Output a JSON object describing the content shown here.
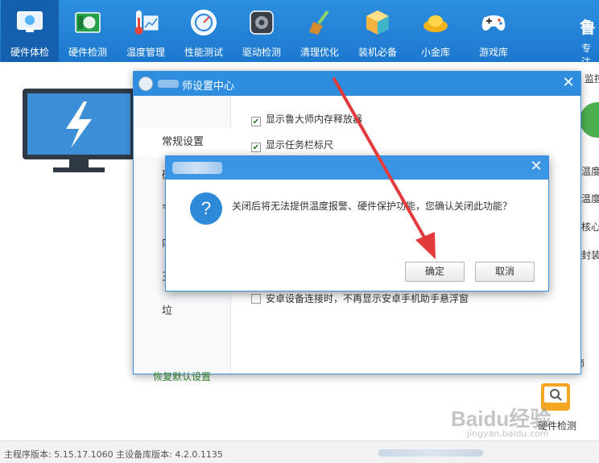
{
  "toolbar": {
    "items": [
      {
        "label": "硬件体检",
        "icon": "monitor-check-icon"
      },
      {
        "label": "硬件检测",
        "icon": "chip-board-icon"
      },
      {
        "label": "温度管理",
        "icon": "thermometer-icon"
      },
      {
        "label": "性能测试",
        "icon": "speedometer-icon"
      },
      {
        "label": "驱动检测",
        "icon": "driver-gear-icon"
      },
      {
        "label": "清理优化",
        "icon": "broom-icon"
      },
      {
        "label": "装机必备",
        "icon": "cube-box-icon"
      },
      {
        "label": "小金库",
        "icon": "gold-ingot-icon"
      },
      {
        "label": "游戏库",
        "icon": "gamepad-icon"
      }
    ],
    "brand_char": "鲁",
    "brand_sub": "专注"
  },
  "right_panel": {
    "monitor_label": "监控",
    "items": [
      "温度",
      "温度",
      "核心",
      "封装"
    ],
    "footer_char": "师",
    "hw_check_label": "硬件检测"
  },
  "settings_dialog": {
    "title": "师设置中心",
    "nav": [
      {
        "label": "常规设置",
        "active": true
      },
      {
        "label": "硬件保护",
        "active": false
      },
      {
        "label": "节",
        "active": false
      },
      {
        "label": "内",
        "active": false
      },
      {
        "label": "王",
        "active": false
      },
      {
        "label": "垃",
        "active": false
      }
    ],
    "reset_label": "恢复默认设置",
    "options": [
      {
        "label": "显示鲁大师内存释放器",
        "checked": true
      },
      {
        "label": "显示任务栏标尺",
        "checked": true
      },
      {
        "label": "安卓设备连接时，不再显示安卓手机助手悬浮窗",
        "checked": false
      }
    ]
  },
  "confirm_dialog": {
    "message": "关闭后将无法提供温度报警、硬件保护功能，您确认关闭此功能？",
    "ok_label": "确定",
    "cancel_label": "取消"
  },
  "status_bar": {
    "text": "主程序版本: 5.15.17.1060   主设备库版本: 4.2.0.1135"
  },
  "watermark": {
    "text": "Baidu经验",
    "sub": "jingyan.baidu.com"
  },
  "colors": {
    "toolbar_blue": "#1c78cf",
    "dialog_blue": "#2f8de0",
    "annotation_red": "#e23b3b"
  }
}
